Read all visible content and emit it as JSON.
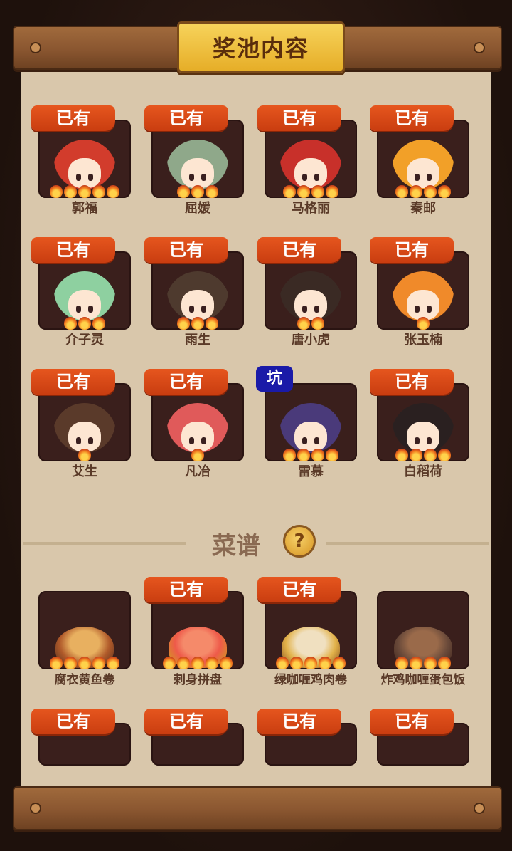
{
  "title": "奖池内容",
  "owned_label": "已有",
  "pit_label": "坑",
  "characters": [
    {
      "name": "郭福",
      "badge": "owned",
      "stars": 5,
      "hair": "#d23c2c"
    },
    {
      "name": "屈媛",
      "badge": "owned",
      "stars": 3,
      "hair": "#8fa88a"
    },
    {
      "name": "马格丽",
      "badge": "owned",
      "stars": 4,
      "hair": "#c8302a"
    },
    {
      "name": "秦邮",
      "badge": "owned",
      "stars": 4,
      "hair": "#f2a028"
    },
    {
      "name": "介子灵",
      "badge": "owned",
      "stars": 3,
      "hair": "#8ed0a0"
    },
    {
      "name": "雨生",
      "badge": "owned",
      "stars": 3,
      "hair": "#4e3a2e"
    },
    {
      "name": "唐小虎",
      "badge": "owned",
      "stars": 2,
      "hair": "#3a2a24"
    },
    {
      "name": "张玉楠",
      "badge": "owned",
      "stars": 1,
      "hair": "#f08a2a"
    },
    {
      "name": "艾生",
      "badge": "owned",
      "stars": 1,
      "hair": "#5a3a2a"
    },
    {
      "name": "凡冶",
      "badge": "owned",
      "stars": 1,
      "hair": "#e05a5a"
    },
    {
      "name": "雷慕",
      "badge": "pit",
      "stars": 4,
      "hair": "#4a3a7a"
    },
    {
      "name": "白稻荷",
      "badge": "owned",
      "stars": 4,
      "hair": "#2a2020"
    }
  ],
  "recipes_section": {
    "label": "菜谱",
    "help": "?"
  },
  "recipes": [
    {
      "name": "腐衣黄鱼卷",
      "badge": "none",
      "stars": 5,
      "tone": ""
    },
    {
      "name": "刺身拼盘",
      "badge": "owned",
      "stars": 5,
      "tone": "red"
    },
    {
      "name": "绿咖喱鸡肉卷",
      "badge": "owned",
      "stars": 5,
      "tone": "white"
    },
    {
      "name": "炸鸡咖喱蛋包饭",
      "badge": "none",
      "stars": 4,
      "tone": "brown"
    },
    {
      "name": "",
      "badge": "owned",
      "stars": 0,
      "tone": ""
    },
    {
      "name": "",
      "badge": "owned",
      "stars": 0,
      "tone": ""
    },
    {
      "name": "",
      "badge": "owned",
      "stars": 0,
      "tone": ""
    },
    {
      "name": "",
      "badge": "owned",
      "stars": 0,
      "tone": ""
    }
  ],
  "colors": {
    "parchment": "#d9c7ab",
    "badge": "#d9491a",
    "pit": "#1a1aa8",
    "frame": "#3a1f1c"
  }
}
